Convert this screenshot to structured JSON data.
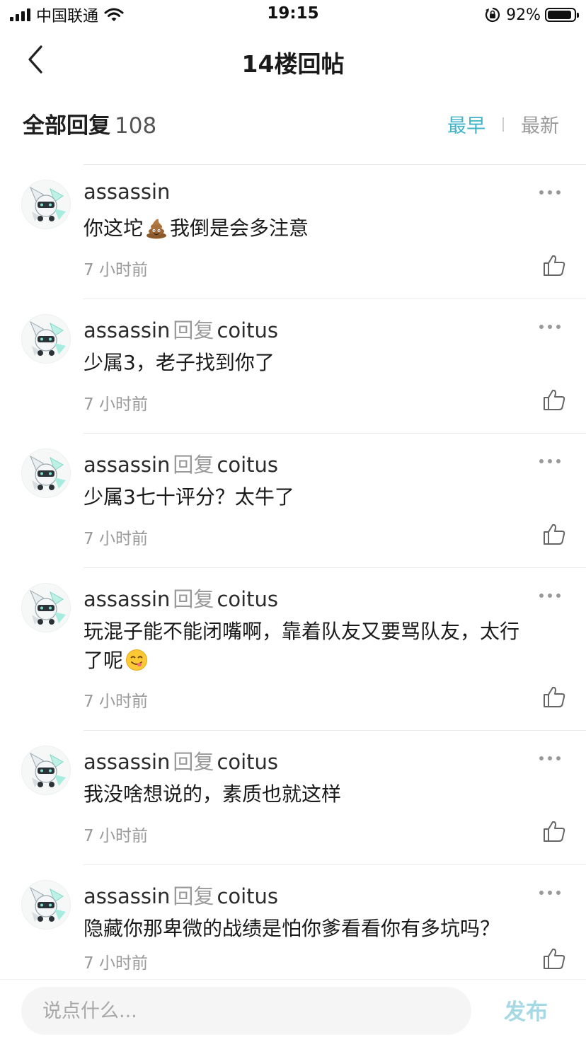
{
  "status_bar": {
    "carrier": "中国联通",
    "time": "19:15",
    "battery": "92%",
    "battery_level": 0.92
  },
  "nav": {
    "title": "14楼回帖"
  },
  "replies_header": {
    "label": "全部回复",
    "count": "108",
    "sort_earliest": "最早",
    "sort_latest": "最新",
    "active_sort": "最早"
  },
  "comments": [
    {
      "author": "assassin",
      "reply_word": "",
      "reply_to": "",
      "lines": [
        "你这坨",
        "💩",
        "我倒是会多注意"
      ],
      "time": "7 小时前"
    },
    {
      "author": "assassin",
      "reply_word": "回复",
      "reply_to": "coitus",
      "text": "少属3，老子找到你了",
      "time": "7 小时前"
    },
    {
      "author": "assassin",
      "reply_word": "回复",
      "reply_to": "coitus",
      "text": "少属3七十评分？太牛了",
      "time": "7 小时前"
    },
    {
      "author": "assassin",
      "reply_word": "回复",
      "reply_to": "coitus",
      "text1": "玩混子能不能闭嘴啊，靠着队友又要骂队友，太行",
      "text2": "了呢",
      "time": "7 小时前"
    },
    {
      "author": "assassin",
      "reply_word": "回复",
      "reply_to": "coitus",
      "text": "我没啥想说的，素质也就这样",
      "time": "7 小时前"
    },
    {
      "author": "assassin",
      "reply_word": "回复",
      "reply_to": "coitus",
      "text": "隐藏你那卑微的战绩是怕你爹看看你有多坑吗？",
      "time": "7 小时前"
    }
  ],
  "bottom_bar": {
    "placeholder": "说点什么...",
    "publish": "发布"
  },
  "colors": {
    "accent": "#3fb3c7",
    "publish_disabled": "#a6d9e3",
    "muted": "#9a9a9a"
  }
}
